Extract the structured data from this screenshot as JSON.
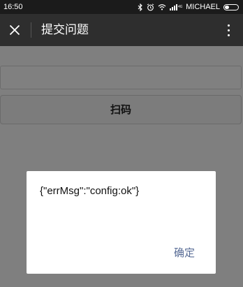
{
  "status_bar": {
    "time": "16:50",
    "carrier": "MICHAEL",
    "signal_text": "4G"
  },
  "nav": {
    "title": "提交问题"
  },
  "form": {
    "input_value": "",
    "scan_label": "扫码"
  },
  "dialog": {
    "message": "{\"errMsg\":\"config:ok\"}",
    "confirm_label": "确定"
  },
  "colors": {
    "nav_bar": "#2e2e2e",
    "status_bar": "#1b1b1b",
    "overlay_bg": "#7f7f7f",
    "dialog_confirm": "#576b95"
  }
}
